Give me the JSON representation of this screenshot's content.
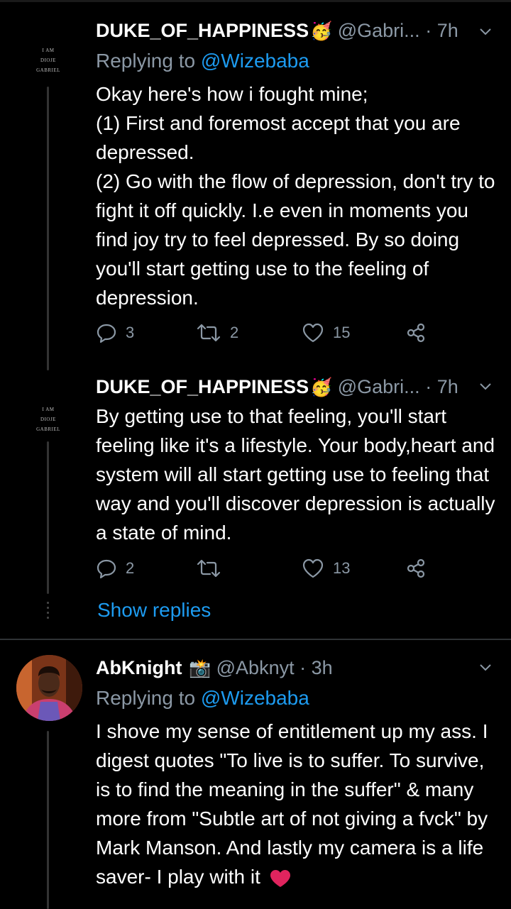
{
  "tweets": [
    {
      "name": "DUKE_OF_HAPPINESS",
      "name_emoji": "🥳",
      "handle": "@Gabri...",
      "time": "7h",
      "avatar_text": [
        "I AM",
        "DIOJE",
        "GABRIEL"
      ],
      "replying_label": "Replying to",
      "replying_handle": "@Wizebaba",
      "lines": [
        "Okay here's how i fought mine;",
        "(1) First and foremost accept that you are depressed.",
        "(2) Go with the flow of depression, don't try to fight it off quickly. I.e even in moments you find joy try to feel depressed. By so doing you'll start getting use to the feeling of depression."
      ],
      "replies": "3",
      "retweets": "2",
      "likes": "15"
    },
    {
      "name": "DUKE_OF_HAPPINESS",
      "name_emoji": "🥳",
      "handle": "@Gabri...",
      "time": "7h",
      "avatar_text": [
        "I AM",
        "DIOJE",
        "GABRIEL"
      ],
      "lines": [
        "By getting use to that feeling, you'll start feeling like it's a lifestyle. Your body,heart and system will all start getting use to feeling that way and you'll discover depression is actually a state of mind."
      ],
      "replies": "2",
      "retweets": "",
      "likes": "13"
    },
    {
      "name": "AbKnight",
      "name_emoji": "📸",
      "handle": "@Abknyt",
      "time": "3h",
      "replying_label": "Replying to",
      "replying_handle": "@Wizebaba",
      "lines": [
        "I shove my sense of entitlement up my ass. I digest quotes \"To live is to suffer. To survive, is to find the meaning in the suffer\" & many more from \"Subtle art of not giving a fvck\" by Mark Manson. And lastly my camera is a life saver- I play with it"
      ]
    }
  ],
  "show_replies": "Show replies",
  "dot_sep": "·",
  "colors": {
    "accent": "#1d9bf0",
    "muted": "#8b98a5",
    "background": "#000000",
    "heart": "#e0245e"
  },
  "icons": [
    "reply-icon",
    "retweet-icon",
    "like-icon",
    "share-icon",
    "chevron-down-icon",
    "heart-emoji-icon"
  ]
}
